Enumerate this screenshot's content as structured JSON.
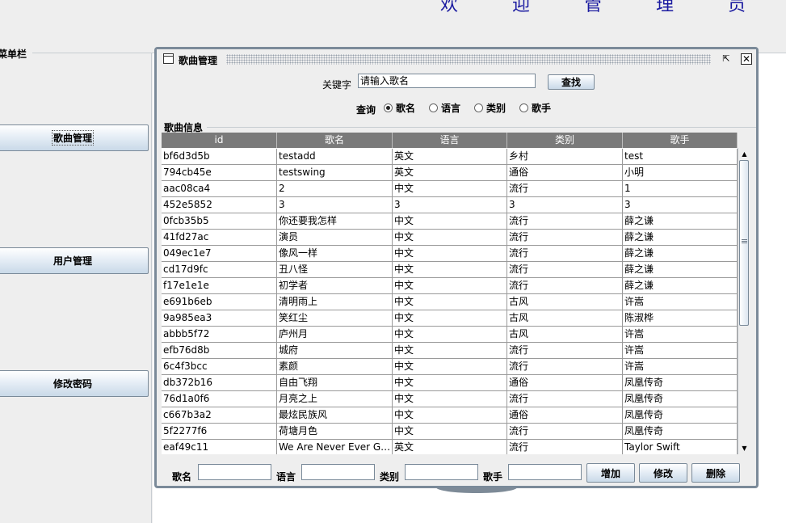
{
  "banner": {
    "welcome": "欢 迎 管 理 员 adm"
  },
  "menu": {
    "title": "菜单栏",
    "items": [
      {
        "label": "歌曲管理"
      },
      {
        "label": "用户管理"
      },
      {
        "label": "修改密码"
      }
    ]
  },
  "window": {
    "title": "歌曲管理",
    "restore_glyph": "⇱",
    "close_glyph": "✕"
  },
  "search": {
    "keyword_label": "关键字",
    "keyword_value": "请输入歌名",
    "find_button": "查找",
    "query_label": "查询",
    "options": [
      {
        "label": "歌名",
        "selected": true
      },
      {
        "label": "语言",
        "selected": false
      },
      {
        "label": "类别",
        "selected": false
      },
      {
        "label": "歌手",
        "selected": false
      }
    ]
  },
  "group_title": "歌曲信息",
  "table": {
    "columns": [
      "id",
      "歌名",
      "语言",
      "类别",
      "歌手"
    ],
    "rows": [
      [
        "bf6d3d5b",
        "testadd",
        "英文",
        "乡村",
        "test"
      ],
      [
        "794cb45e",
        "testswing",
        "英文",
        "通俗",
        "小明"
      ],
      [
        "aac08ca4",
        "2",
        "中文",
        "流行",
        "1"
      ],
      [
        "452e5852",
        "3",
        "3",
        "3",
        "3"
      ],
      [
        "0fcb35b5",
        "你还要我怎样",
        "中文",
        "流行",
        "薛之谦"
      ],
      [
        "41fd27ac",
        "演员",
        "中文",
        "流行",
        "薛之谦"
      ],
      [
        "049ec1e7",
        "像风一样",
        "中文",
        "流行",
        "薛之谦"
      ],
      [
        "cd17d9fc",
        "丑八怪",
        "中文",
        "流行",
        "薛之谦"
      ],
      [
        "f17e1e1e",
        "初学者",
        "中文",
        "流行",
        "薛之谦"
      ],
      [
        "e691b6eb",
        "清明雨上",
        "中文",
        "古风",
        "许嵩"
      ],
      [
        "9a985ea3",
        "笑红尘",
        "中文",
        "古风",
        "陈淑桦"
      ],
      [
        "abbb5f72",
        "庐州月",
        "中文",
        "古风",
        "许嵩"
      ],
      [
        "efb76d8b",
        "城府",
        "中文",
        "流行",
        "许嵩"
      ],
      [
        "6c4f3bcc",
        "素颜",
        "中文",
        "流行",
        "许嵩"
      ],
      [
        "db372b16",
        "自由飞翔",
        "中文",
        "通俗",
        "凤凰传奇"
      ],
      [
        "76d1a0f6",
        "月亮之上",
        "中文",
        "流行",
        "凤凰传奇"
      ],
      [
        "c667b3a2",
        "最炫民族风",
        "中文",
        "通俗",
        "凤凰传奇"
      ],
      [
        "5f2277f6",
        "荷塘月色",
        "中文",
        "流行",
        "凤凰传奇"
      ],
      [
        "eaf49c11",
        "We Are Never Ever Getti...",
        "英文",
        "流行",
        "Taylor Swift"
      ]
    ]
  },
  "scrollbar": {
    "up_glyph": "▲",
    "down_glyph": "▼"
  },
  "edit": {
    "name_label": "歌名",
    "language_label": "语言",
    "category_label": "类别",
    "singer_label": "歌手",
    "add_button": "增加",
    "modify_button": "修改",
    "delete_button": "删除"
  }
}
